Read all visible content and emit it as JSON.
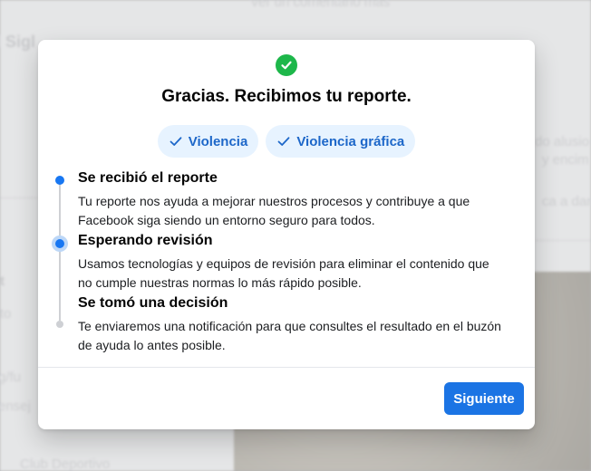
{
  "background": {
    "top_text": "Ver un comentario más",
    "heading_fragment": "l Sigl",
    "side_text_1": "do alusio",
    "side_text_2": "y encim",
    "side_text_3": "ca a dan",
    "left_text_1": "t",
    "left_text_2": "to",
    "left_text_3": "g/fu",
    "left_text_4": "ensej",
    "bottom_text": "Club Deportivo"
  },
  "modal": {
    "icon": "success-check-icon",
    "title": "Gracias. Recibimos tu reporte.",
    "chips": [
      {
        "label": "Violencia",
        "icon": "checkmark-icon"
      },
      {
        "label": "Violencia gráfica",
        "icon": "checkmark-icon"
      }
    ],
    "steps": [
      {
        "title": "Se recibió el reporte",
        "description": "Tu reporte nos ayuda a mejorar nuestros procesos y contribuye a que Facebook siga siendo un entorno seguro para todos.",
        "status": "done"
      },
      {
        "title": "Esperando revisión",
        "description": "Usamos tecnologías y equipos de revisión para eliminar el contenido que no cumple nuestras normas lo más rápido posible.",
        "status": "current"
      },
      {
        "title": "Se tomó una decisión",
        "description": "Te enviaremos una notificación para que consultes el resultado en el buzón de ayuda lo antes posible.",
        "status": "pending"
      }
    ],
    "next_button": "Siguiente"
  },
  "colors": {
    "accent": "#1b74e4",
    "chip_bg": "#e7f3ff",
    "chip_text": "#1d67c9",
    "success": "#1db74a"
  }
}
